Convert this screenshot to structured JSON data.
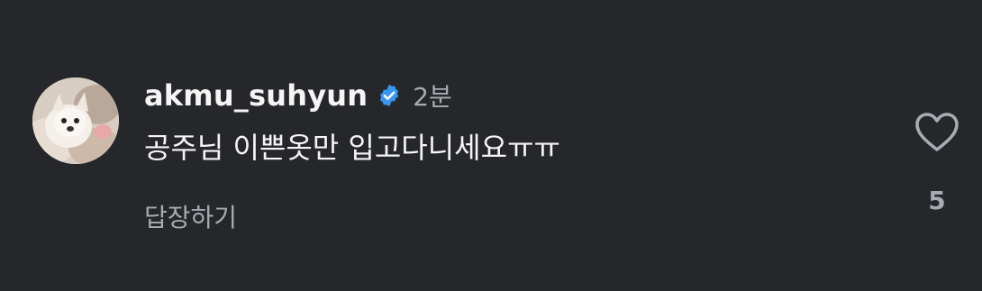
{
  "comment": {
    "username": "akmu_suhyun",
    "verified": true,
    "timestamp": "2분",
    "text": "공주님 이쁜옷만 입고다니세요ㅠㅠ",
    "reply_label": "답장하기",
    "like_count": "5"
  },
  "icons": {
    "verified": "verified-badge-icon",
    "like": "heart-outline-icon"
  },
  "colors": {
    "background": "#25272b",
    "primary_text": "#f5f5f5",
    "secondary_text": "#a8abb2",
    "verified_blue": "#3897f0"
  }
}
